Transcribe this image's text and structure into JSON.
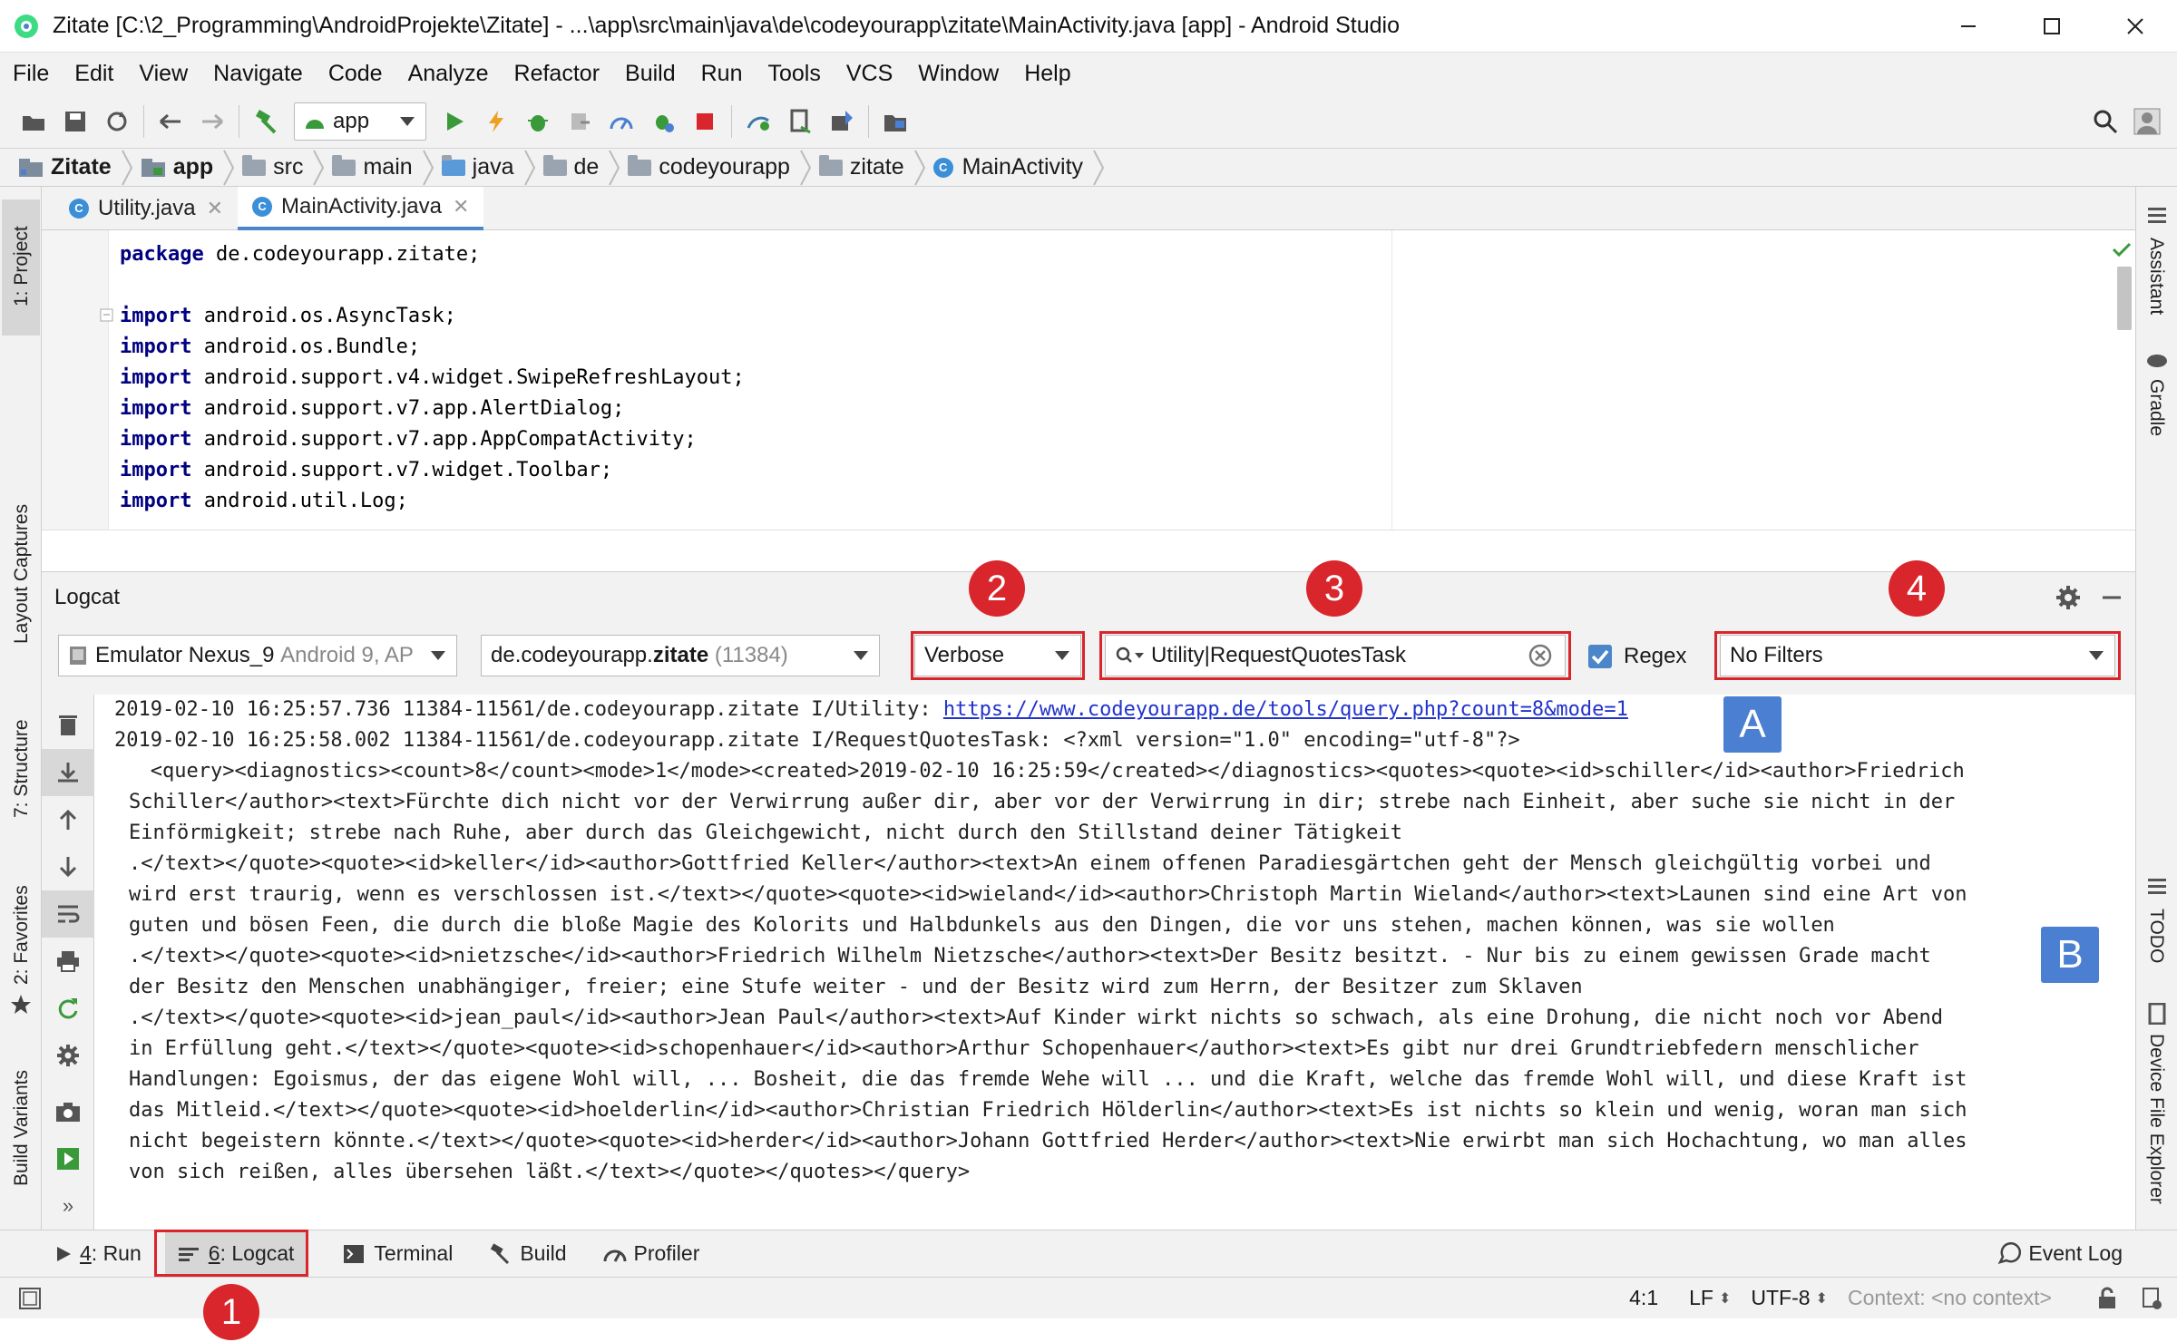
{
  "window": {
    "title": "Zitate [C:\\2_Programming\\AndroidProjekte\\Zitate] - ...\\app\\src\\main\\java\\de\\codeyourapp\\zitate\\MainActivity.java [app] - Android Studio"
  },
  "menu": [
    "File",
    "Edit",
    "View",
    "Navigate",
    "Code",
    "Analyze",
    "Refactor",
    "Build",
    "Run",
    "Tools",
    "VCS",
    "Window",
    "Help"
  ],
  "toolbar": {
    "run_config": "app",
    "icons": [
      "open-folder-icon",
      "save-icon",
      "sync-icon",
      "back-icon",
      "forward-icon",
      "hammer-icon",
      "run-icon",
      "apply-changes-icon",
      "debug-icon",
      "attach-debugger-icon",
      "profile-icon",
      "debug-bug-icon",
      "stop-icon",
      "sync-gradle-icon",
      "avd-manager-icon",
      "sdk-manager-icon",
      "project-structure-icon",
      "search-icon",
      "user-icon"
    ]
  },
  "breadcrumb": [
    "Zitate",
    "app",
    "src",
    "main",
    "java",
    "de",
    "codeyourapp",
    "zitate",
    "MainActivity"
  ],
  "tabs": [
    {
      "label": "Utility.java",
      "active": false
    },
    {
      "label": "MainActivity.java",
      "active": true
    }
  ],
  "left_stripe": [
    "1: Project",
    "Layout Captures",
    "7: Structure",
    "2: Favorites",
    "Build Variants"
  ],
  "right_stripe": [
    "Assistant",
    "Gradle",
    "TODO",
    "Device File Explorer"
  ],
  "code_lines": [
    {
      "kw": "package",
      "rest": " de.codeyourapp.zitate;"
    },
    {
      "kw": "",
      "rest": ""
    },
    {
      "kw": "import",
      "rest": " android.os.AsyncTask;"
    },
    {
      "kw": "import",
      "rest": " android.os.Bundle;"
    },
    {
      "kw": "import",
      "rest": " android.support.v4.widget.SwipeRefreshLayout;"
    },
    {
      "kw": "import",
      "rest": " android.support.v7.app.AlertDialog;"
    },
    {
      "kw": "import",
      "rest": " android.support.v7.app.AppCompatActivity;"
    },
    {
      "kw": "import",
      "rest": " android.support.v7.widget.Toolbar;"
    },
    {
      "kw": "import",
      "rest": " android.util.Log;"
    }
  ],
  "logcat": {
    "title": "Logcat",
    "device": "Emulator Nexus_9",
    "device_detail": "Android 9, AP",
    "process_prefix": "de.codeyourapp.",
    "process_bold": "zitate",
    "process_pid": "(11384)",
    "level": "Verbose",
    "search": "Utility|RequestQuotesTask",
    "regex_label": "Regex",
    "regex_checked": true,
    "filter": "No Filters",
    "line1_prefix": "2019-02-10 16:25:57.736 11384-11561/de.codeyourapp.zitate I/Utility: ",
    "line1_link": "https://www.codeyourapp.de/tools/query.php?count=8&mode=1",
    "lines": [
      "2019-02-10 16:25:58.002 11384-11561/de.codeyourapp.zitate I/RequestQuotesTask: <?xml version=\"1.0\" encoding=\"utf-8\"?>",
      "   <query><diagnostics><count>8</count><mode>1</mode><created>2019-02-10 16:25:59</created></diagnostics><quotes><quote><id>schiller</id><author>Friedrich",
      "Schiller</author><text>Fürchte dich nicht vor der Verwirrung außer dir, aber vor der Verwirrung in dir; strebe nach Einheit, aber suche sie nicht in der",
      "Einförmigkeit; strebe nach Ruhe, aber durch das Gleichgewicht, nicht durch den Stillstand deiner Tätigkeit",
      ".</text></quote><quote><id>keller</id><author>Gottfried Keller</author><text>An einem offenen Paradiesgärtchen geht der Mensch gleichgültig vorbei und",
      "wird erst traurig, wenn es verschlossen ist.</text></quote><quote><id>wieland</id><author>Christoph Martin Wieland</author><text>Launen sind eine Art von",
      "guten und bösen Feen, die durch die bloße Magie des Kolorits und Halbdunkels aus den Dingen, die vor uns stehen, machen können, was sie wollen",
      ".</text></quote><quote><id>nietzsche</id><author>Friedrich Wilhelm Nietzsche</author><text>Der Besitz besitzt. - Nur bis zu einem gewissen Grade macht",
      "der Besitz den Menschen unabhängiger, freier; eine Stufe weiter - und der Besitz wird zum Herrn, der Besitzer zum Sklaven",
      ".</text></quote><quote><id>jean_paul</id><author>Jean Paul</author><text>Auf Kinder wirkt nichts so schwach, als eine Drohung, die nicht noch vor Abend",
      "in Erfüllung geht.</text></quote><quote><id>schopenhauer</id><author>Arthur Schopenhauer</author><text>Es gibt nur drei Grundtriebfedern menschlicher",
      "Handlungen: Egoismus, der das eigene Wohl will, ... Bosheit, die das fremde Wehe will ... und die Kraft, welche das fremde Wohl will, und diese Kraft ist",
      "das Mitleid.</text></quote><quote><id>hoelderlin</id><author>Christian Friedrich Hölderlin</author><text>Es ist nichts so klein und wenig, woran man sich",
      "nicht begeistern könnte.</text></quote><quote><id>herder</id><author>Johann Gottfried Herder</author><text>Nie erwirbt man sich Hochachtung, wo man alles",
      "von sich reißen, alles übersehen läßt.</text></quote></quotes></query>"
    ]
  },
  "annotations": {
    "badges": [
      "1",
      "2",
      "3",
      "4"
    ],
    "letters": [
      "A",
      "B"
    ]
  },
  "bottom_tools": [
    {
      "key": "4",
      "label": ": Run"
    },
    {
      "key": "6",
      "label": ": Logcat"
    },
    {
      "key": "",
      "label": "Terminal"
    },
    {
      "key": "",
      "label": "Build"
    },
    {
      "key": "",
      "label": "Profiler"
    }
  ],
  "event_log": "Event Log",
  "status": {
    "position": "4:1",
    "line_sep": "LF",
    "encoding": "UTF-8",
    "context": "Context: <no context>"
  },
  "colors": {
    "highlight_red": "#d9262c",
    "label_blue": "#4a7fd1",
    "keyword": "#000080",
    "link": "#2233cc"
  }
}
